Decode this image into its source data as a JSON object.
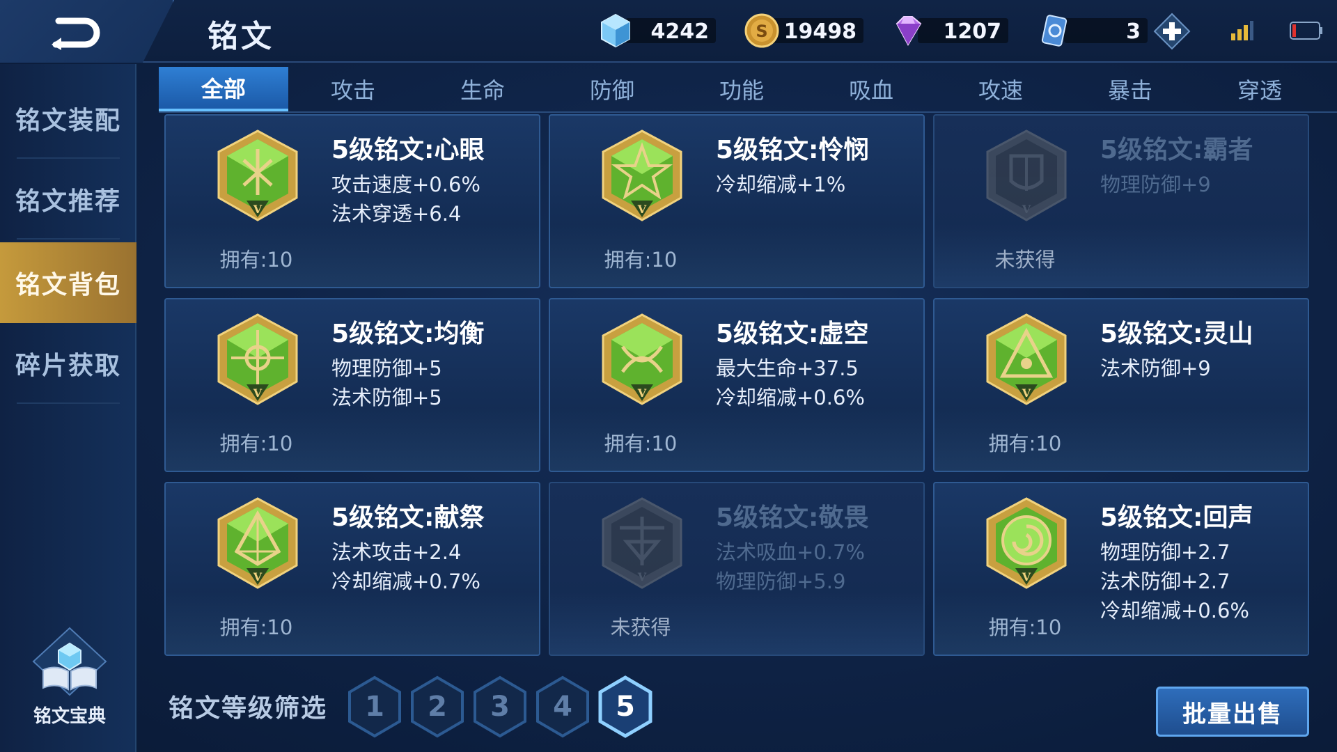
{
  "header": {
    "title": "铭文",
    "currencies": [
      {
        "icon": "crystal-icon",
        "value": "4242"
      },
      {
        "icon": "gold-coin-icon",
        "value": "19498"
      },
      {
        "icon": "diamond-icon",
        "value": "1207"
      },
      {
        "icon": "voucher-icon",
        "value": "3"
      }
    ]
  },
  "sidebar": {
    "items": [
      {
        "label": "铭文装配",
        "active": false
      },
      {
        "label": "铭文推荐",
        "active": false
      },
      {
        "label": "铭文背包",
        "active": true
      },
      {
        "label": "碎片获取",
        "active": false
      }
    ],
    "codex_label": "铭文宝典"
  },
  "tabs": [
    {
      "label": "全部",
      "active": true
    },
    {
      "label": "攻击"
    },
    {
      "label": "生命"
    },
    {
      "label": "防御"
    },
    {
      "label": "功能"
    },
    {
      "label": "吸血"
    },
    {
      "label": "攻速"
    },
    {
      "label": "暴击"
    },
    {
      "label": "穿透"
    }
  ],
  "cards": [
    {
      "name": "5级铭文:心眼",
      "stats": [
        "攻击速度+0.6%",
        "法术穿透+6.4"
      ],
      "own": "拥有:10",
      "locked": false
    },
    {
      "name": "5级铭文:怜悯",
      "stats": [
        "冷却缩减+1%"
      ],
      "own": "拥有:10",
      "locked": false
    },
    {
      "name": "5级铭文:霸者",
      "stats": [
        "物理防御+9"
      ],
      "own": "未获得",
      "locked": true
    },
    {
      "name": "5级铭文:均衡",
      "stats": [
        "物理防御+5",
        "法术防御+5"
      ],
      "own": "拥有:10",
      "locked": false
    },
    {
      "name": "5级铭文:虚空",
      "stats": [
        "最大生命+37.5",
        "冷却缩减+0.6%"
      ],
      "own": "拥有:10",
      "locked": false
    },
    {
      "name": "5级铭文:灵山",
      "stats": [
        "法术防御+9"
      ],
      "own": "拥有:10",
      "locked": false
    },
    {
      "name": "5级铭文:献祭",
      "stats": [
        "法术攻击+2.4",
        "冷却缩减+0.7%"
      ],
      "own": "拥有:10",
      "locked": false
    },
    {
      "name": "5级铭文:敬畏",
      "stats": [
        "法术吸血+0.7%",
        "物理防御+5.9"
      ],
      "own": "未获得",
      "locked": true
    },
    {
      "name": "5级铭文:回声",
      "stats": [
        "物理防御+2.7",
        "法术防御+2.7",
        "冷却缩减+0.6%"
      ],
      "own": "拥有:10",
      "locked": false
    }
  ],
  "filter": {
    "label": "铭文等级筛选",
    "levels": [
      "1",
      "2",
      "3",
      "4",
      "5"
    ],
    "selected": "5"
  },
  "sell_button": "批量出售",
  "colors": {
    "accent_blue": "#2f7fd4",
    "active_gold": "#c59a3c",
    "emblem_green": "#7ed43a",
    "emblem_gold": "#d9b04a"
  }
}
